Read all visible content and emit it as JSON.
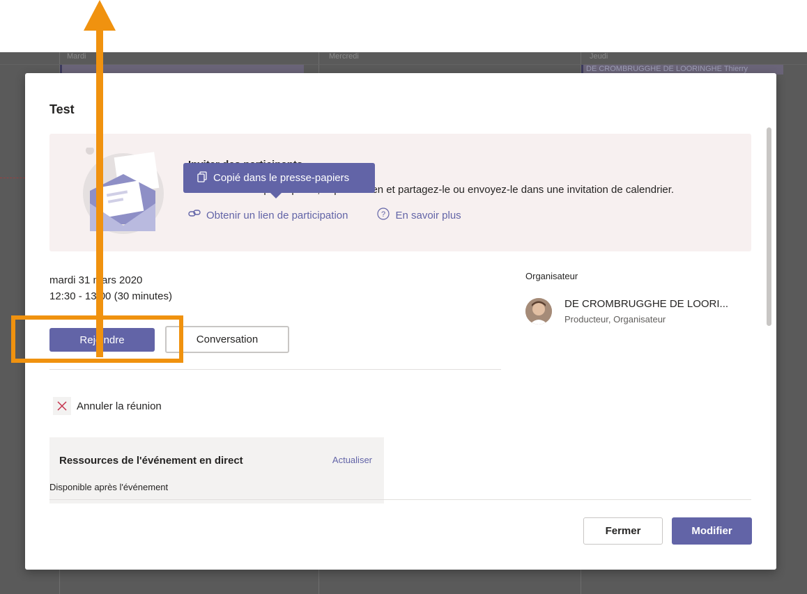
{
  "background": {
    "days": [
      "Mardi",
      "Mercredi",
      "Jeudi"
    ],
    "events": [
      "DE CROMBRUGGHE DE LOORINGHE Thierry"
    ]
  },
  "dialog": {
    "title": "Test",
    "invite": {
      "heading": "Inviter des participants",
      "text": "Pour inviter des participants, copiez le lien et partagez-le ou envoyez-le dans une invitation de calendrier.",
      "get_link": "Obtenir un lien de participation",
      "learn_more": "En savoir plus"
    },
    "tooltip": "Copié dans le presse-papiers",
    "date": "mardi 31 mars 2020",
    "time": "12:30 - 13:00 (30 minutes)",
    "join_label": "Rejoindre",
    "conversation_label": "Conversation",
    "cancel_label": "Annuler la réunion",
    "resources": {
      "title": "Ressources de l'événement en direct",
      "refresh": "Actualiser",
      "subtitle": "Disponible après l'événement"
    },
    "organizer": {
      "label": "Organisateur",
      "name": "DE CROMBRUGGHE DE LOORI...",
      "role": "Producteur, Organisateur"
    },
    "close_label": "Fermer",
    "edit_label": "Modifier"
  },
  "colors": {
    "accent": "#6264a7",
    "annotation": "#f0920f",
    "invite_bg": "#f7f0f0",
    "cancel_icon": "#c4314b"
  },
  "icons": [
    "copy-icon",
    "link-icon",
    "help-icon",
    "close-x-icon",
    "up-arrow-icon"
  ]
}
